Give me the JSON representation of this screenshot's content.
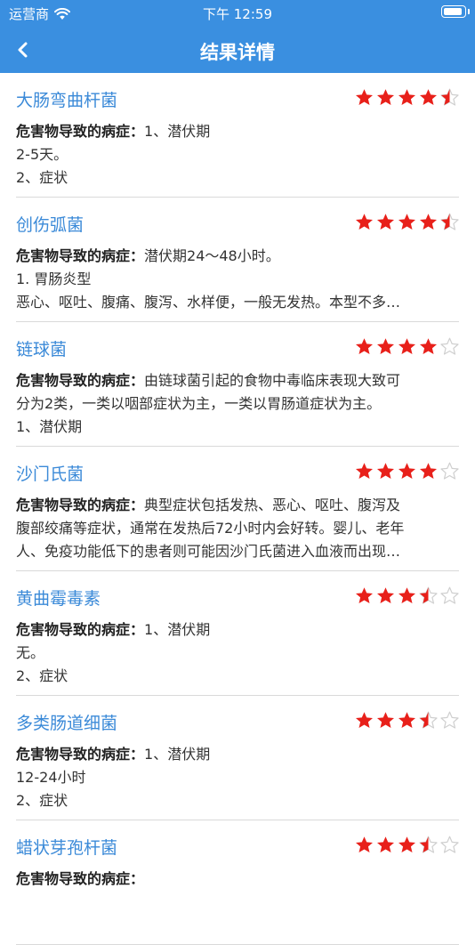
{
  "status": {
    "carrier": "运营商",
    "time": "下午 12:59"
  },
  "nav": {
    "title": "结果详情"
  },
  "label_prefix": "危害物导致的病症：",
  "items": [
    {
      "name": "大肠弯曲杆菌",
      "rating": 4.5,
      "line1": "1、潜伏期",
      "line2": "2-5天。",
      "line3": "2、症状"
    },
    {
      "name": "创伤弧菌",
      "rating": 4.5,
      "line1": "潜伏期24～48小时。",
      "line2": "1. 胃肠炎型",
      "line3": "恶心、呕吐、腹痛、腹泻、水样便，一般无发热。本型不多…"
    },
    {
      "name": "链球菌",
      "rating": 4,
      "line1": "由链球菌引起的食物中毒临床表现大致可",
      "line2": "分为2类，一类以咽部症状为主，一类以胃肠道症状为主。",
      "line3": "1、潜伏期"
    },
    {
      "name": "沙门氏菌",
      "rating": 4,
      "line1": "典型症状包括发热、恶心、呕吐、腹泻及",
      "line2": "腹部绞痛等症状，通常在发热后72小时内会好转。婴儿、老年",
      "line3": "人、免疫功能低下的患者则可能因沙门氏菌进入血液而出现…"
    },
    {
      "name": "黄曲霉毒素",
      "rating": 3.5,
      "line1": "1、潜伏期",
      "line2": "无。",
      "line3": "2、症状"
    },
    {
      "name": "多类肠道细菌",
      "rating": 3.5,
      "line1": "1、潜伏期",
      "line2": "12-24小时",
      "line3": "2、症状"
    },
    {
      "name": "蜡状芽孢杆菌",
      "rating": 3.5,
      "line1": "",
      "line2": "",
      "line3": ""
    }
  ],
  "colors": {
    "accent": "#3a8fe0",
    "star": "#e8201a",
    "star_empty": "#cfcfcf",
    "name": "#3b8ad8"
  }
}
